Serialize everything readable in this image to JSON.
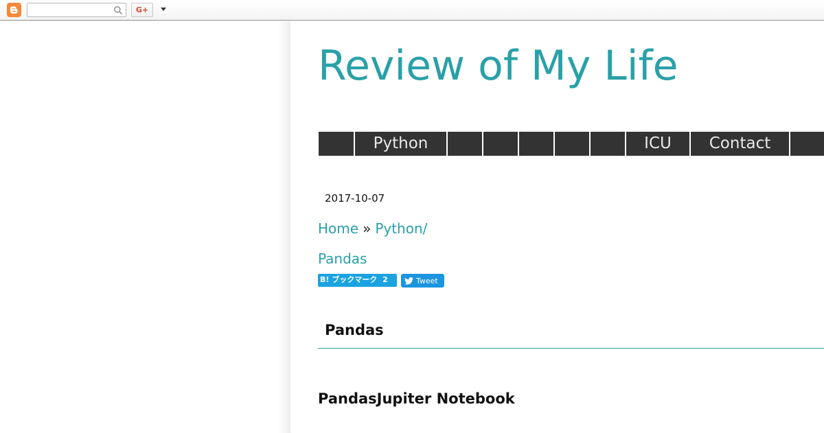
{
  "navbar": {
    "search_placeholder": "",
    "gplus_label": "G+",
    "logo_icon": "blogger-icon",
    "search_icon": "search-icon",
    "more_icon": "caret-down-icon"
  },
  "blog": {
    "title": "Review of My Life",
    "accent_color": "#2aa0a8"
  },
  "menu": {
    "items": [
      {
        "label": ""
      },
      {
        "label": "Python"
      },
      {
        "label": ""
      },
      {
        "label": ""
      },
      {
        "label": ""
      },
      {
        "label": ""
      },
      {
        "label": ""
      },
      {
        "label": "ICU"
      },
      {
        "label": "Contact"
      },
      {
        "label": ""
      }
    ]
  },
  "post": {
    "date": "2017-10-07",
    "breadcrumb": {
      "home": "Home",
      "separator": "»",
      "category": "Python/",
      "current": "Pandas"
    },
    "share": {
      "hatena_label": "ブックマーク",
      "hatena_prefix": "B!",
      "hatena_count": "2",
      "tweet_label": "Tweet"
    },
    "title": "Pandas",
    "section_heading": "PandasJupiter Notebook"
  }
}
